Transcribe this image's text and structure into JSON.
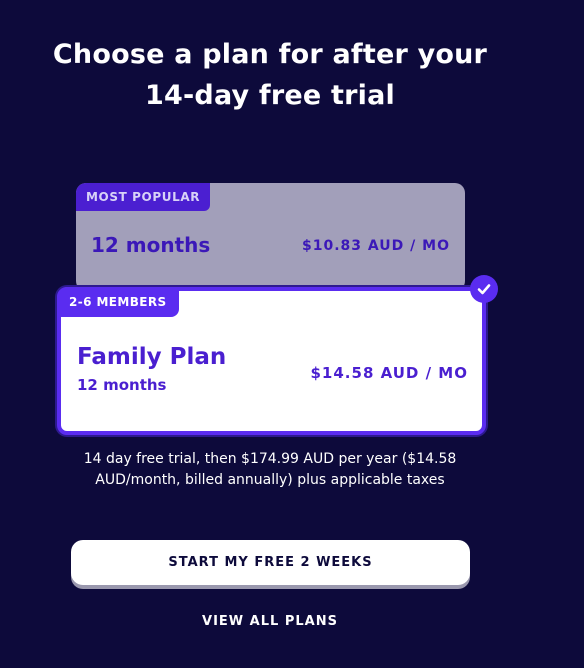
{
  "heading": {
    "line1": "Choose a plan for after your",
    "line2": "14-day free trial"
  },
  "plans": [
    {
      "badge": "MOST POPULAR",
      "term": "12 months",
      "price": "$10.83 AUD / MO",
      "selected": false
    },
    {
      "badge": "2-6 MEMBERS",
      "name": "Family Plan",
      "term": "12 months",
      "price": "$14.58 AUD / MO",
      "selected": true,
      "selected_icon": "check-circle-icon"
    }
  ],
  "terms_text": "14 day free trial, then $174.99 AUD per year ($14.58 AUD/month, billed annually) plus applicable taxes",
  "cta": {
    "primary_label": "START MY FREE 2 WEEKS",
    "secondary_label": "VIEW ALL PLANS"
  },
  "colors": {
    "background": "#0d0a3b",
    "accent": "#5a2cf0",
    "unselected_card": "#a29fba"
  }
}
